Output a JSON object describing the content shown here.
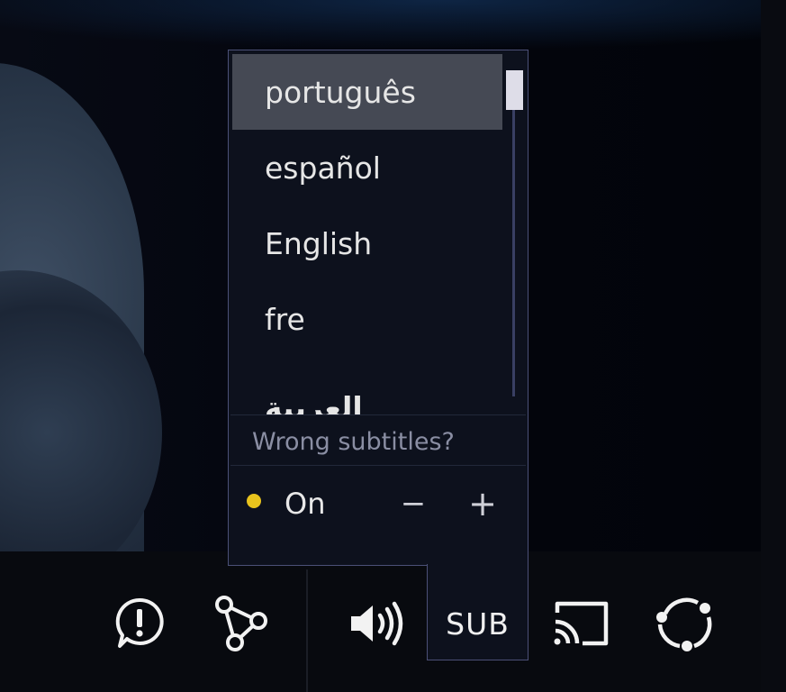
{
  "subtitles": {
    "tab_label": "SUB",
    "languages": [
      {
        "label": "português",
        "selected": true
      },
      {
        "label": "español",
        "selected": false
      },
      {
        "label": "English",
        "selected": false
      },
      {
        "label": "fre",
        "selected": false
      },
      {
        "label": "العربية",
        "selected": false
      }
    ],
    "wrong_link": "Wrong subtitles?",
    "status": "On",
    "decrease_label": "−",
    "increase_label": "+",
    "status_color": "#e8c31d"
  },
  "controls": {
    "icons": [
      "report-icon",
      "share-icon",
      "volume-icon",
      "cast-icon",
      "watch-party-icon"
    ]
  },
  "colors": {
    "panel_bg": "#0d111d",
    "panel_border": "#4b5077",
    "selected_bg": "#454954",
    "control_bar_bg": "#080a0f"
  }
}
